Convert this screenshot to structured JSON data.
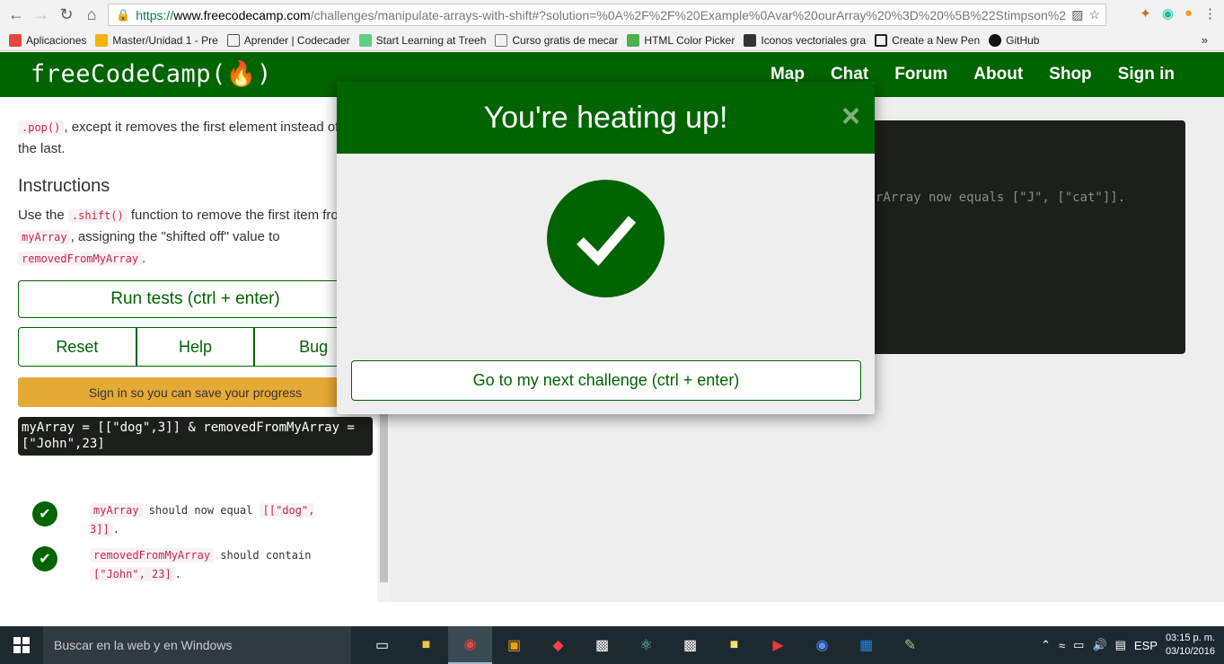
{
  "browser": {
    "url_scheme": "https://",
    "url_host": "www.freecodecamp.com",
    "url_rest": "/challenges/manipulate-arrays-with-shift#?solution=%0A%2F%2F%20Example%0Avar%20ourArray%20%3D%20%5B%22Stimpson%22%2",
    "bookmarks": [
      {
        "label": "Aplicaciones",
        "color": "#3b78e7"
      },
      {
        "label": "Master/Unidad 1 - Pre",
        "color": "#f4b400"
      },
      {
        "label": "Aprender | Codecader",
        "color": "#555555"
      },
      {
        "label": "Start Learning at Treeh",
        "color": "#5fcf80"
      },
      {
        "label": "Curso gratis de mecar",
        "color": "#ffffff"
      },
      {
        "label": "HTML Color Picker",
        "color": "#4caf50"
      },
      {
        "label": "Iconos vectoriales gra",
        "color": "#333333"
      },
      {
        "label": "Create a New Pen",
        "color": "#222222"
      },
      {
        "label": "GitHub",
        "color": "#111111"
      }
    ],
    "bookmarks_more": "»"
  },
  "navbar": {
    "logo": "freeCodeCamp(🔥)",
    "links": [
      "Map",
      "Chat",
      "Forum",
      "About",
      "Shop",
      "Sign in"
    ]
  },
  "challenge": {
    "desc_code": ".pop()",
    "desc_text": ", except it removes the first element instead of the last.",
    "instructions_heading": "Instructions",
    "instr_pre": "Use the ",
    "instr_code1": ".shift()",
    "instr_mid": " function to remove the first item from ",
    "instr_code2": "myArray",
    "instr_mid2": ", assigning the \"shifted off\" value to ",
    "instr_code3": "removedFromMyArray",
    "instr_end": ".",
    "run_tests": "Run tests (ctrl + enter)",
    "reset": "Reset",
    "help": "Help",
    "bug": "Bug",
    "signin_notice": "Sign in so you can save your progress",
    "output": "myArray = [[\"dog\",3]] & removedFromMyArray = [\"John\",23]",
    "tests": [
      {
        "code": "myArray",
        "text": " should now equal ",
        "code2": "[[\"dog\", 3]]",
        "end": "."
      },
      {
        "code": "removedFromMyArray",
        "text": " should contain ",
        "code2": "[\"John\", 23]",
        "end": "."
      }
    ]
  },
  "editor": {
    "visible_text": "rArray now equals [\"J\", [\"cat\"]]."
  },
  "modal": {
    "title": "You're heating up!",
    "close": "×",
    "next_button": "Go to my next challenge (ctrl + enter)"
  },
  "taskbar": {
    "search_placeholder": "Buscar en la web y en Windows",
    "language": "ESP",
    "time": "03:15 p. m.",
    "date": "03/10/2016"
  }
}
